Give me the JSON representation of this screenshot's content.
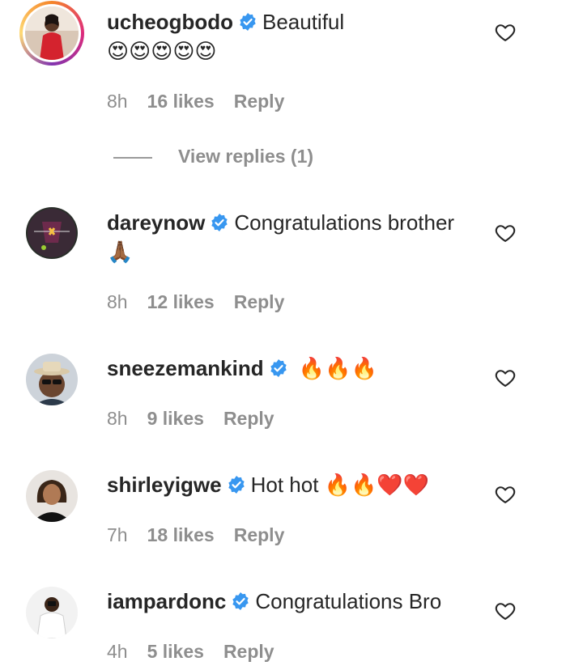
{
  "comments": [
    {
      "username": "ucheogbodo",
      "text": "Beautiful",
      "emojis": "😍😍😍😍😍",
      "time": "8h",
      "likes": "16 likes",
      "reply": "Reply"
    },
    {
      "username": "dareynow",
      "text": "Congratulations brother",
      "emojis": "🙏🏾",
      "time": "8h",
      "likes": "12 likes",
      "reply": "Reply"
    },
    {
      "username": "sneezemankind",
      "text": "",
      "emojis": "🔥🔥🔥",
      "time": "8h",
      "likes": "9 likes",
      "reply": "Reply"
    },
    {
      "username": "shirleyigwe",
      "text": "Hot hot",
      "emojis": "🔥🔥❤️❤️",
      "time": "7h",
      "likes": "18 likes",
      "reply": "Reply"
    },
    {
      "username": "iampardonc",
      "text": "Congratulations Bro",
      "emojis": "",
      "time": "4h",
      "likes": "5 likes",
      "reply": "Reply"
    }
  ],
  "view_replies": "View replies (1)",
  "colors": {
    "text": "#262626",
    "muted": "#8e8e8e",
    "verified": "#3897f0"
  },
  "icons": {
    "verified": "verified-badge-icon",
    "like": "heart-outline-icon"
  }
}
